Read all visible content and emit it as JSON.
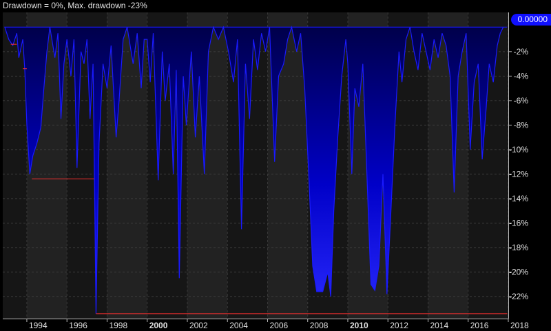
{
  "chart_data": {
    "type": "area",
    "title": "Drawdown = 0%, Max. drawdown -23%",
    "ylim": [
      -23.8,
      1.2
    ],
    "y_ticks": [
      {
        "value": -2,
        "label": "-2%"
      },
      {
        "value": -4,
        "label": "-4%"
      },
      {
        "value": -6,
        "label": "-6%"
      },
      {
        "value": -8,
        "label": "-8%"
      },
      {
        "value": -10,
        "label": "-10%"
      },
      {
        "value": -12,
        "label": "-12%"
      },
      {
        "value": -14,
        "label": "-14%"
      },
      {
        "value": -16,
        "label": "-16%"
      },
      {
        "value": -18,
        "label": "-18%"
      },
      {
        "value": -20,
        "label": "-20%"
      },
      {
        "value": -22,
        "label": "-22%"
      }
    ],
    "x_ticks": [
      {
        "year": 1994,
        "label": "1994",
        "bold": false
      },
      {
        "year": 1996,
        "label": "1996",
        "bold": false
      },
      {
        "year": 1998,
        "label": "1998",
        "bold": false
      },
      {
        "year": 2000,
        "label": "2000",
        "bold": true
      },
      {
        "year": 2002,
        "label": "2002",
        "bold": false
      },
      {
        "year": 2004,
        "label": "2004",
        "bold": false
      },
      {
        "year": 2006,
        "label": "2006",
        "bold": false
      },
      {
        "year": 2008,
        "label": "2008",
        "bold": false
      },
      {
        "year": 2010,
        "label": "2010",
        "bold": true
      },
      {
        "year": 2012,
        "label": "2012",
        "bold": false
      },
      {
        "year": 2014,
        "label": "2014",
        "bold": false
      },
      {
        "year": 2016,
        "label": "2016",
        "bold": false
      },
      {
        "year": 2018,
        "label": "2018",
        "bold": false
      }
    ],
    "last_value_label": "0.00000",
    "series": [
      {
        "type": "area",
        "color": "#1a1aff",
        "points": [
          [
            1992.9,
            0
          ],
          [
            1993.1,
            -1.0
          ],
          [
            1993.3,
            -1.5
          ],
          [
            1993.5,
            -0.5
          ],
          [
            1993.6,
            -2.5
          ],
          [
            1993.8,
            -1.0
          ],
          [
            1993.9,
            -3.5
          ],
          [
            1994.0,
            -8
          ],
          [
            1994.15,
            -12.0
          ],
          [
            1994.3,
            -10.5
          ],
          [
            1994.5,
            -9.5
          ],
          [
            1994.7,
            -8.2
          ],
          [
            1994.85,
            -5
          ],
          [
            1995.0,
            -2
          ],
          [
            1995.15,
            0
          ],
          [
            1995.4,
            -2.5
          ],
          [
            1995.55,
            -0.5
          ],
          [
            1995.7,
            -7.5
          ],
          [
            1995.85,
            -3
          ],
          [
            1996.0,
            -1
          ],
          [
            1996.2,
            -4
          ],
          [
            1996.35,
            -1
          ],
          [
            1996.5,
            -11.5
          ],
          [
            1996.7,
            -2
          ],
          [
            1996.85,
            -3
          ],
          [
            1997.0,
            -1
          ],
          [
            1997.15,
            -7.5
          ],
          [
            1997.3,
            -3
          ],
          [
            1997.45,
            -23.4
          ],
          [
            1997.6,
            -9.5
          ],
          [
            1997.8,
            -3.0
          ],
          [
            1998.0,
            -5.0
          ],
          [
            1998.2,
            -1.5
          ],
          [
            1998.45,
            -9.0
          ],
          [
            1998.6,
            -6.0
          ],
          [
            1998.8,
            -1.0
          ],
          [
            1999.0,
            0
          ],
          [
            1999.3,
            -3.0
          ],
          [
            1999.5,
            -0.5
          ],
          [
            1999.7,
            -5.0
          ],
          [
            1999.85,
            -1
          ],
          [
            2000.0,
            -1
          ],
          [
            2000.15,
            -4.5
          ],
          [
            2000.3,
            -0.5
          ],
          [
            2000.55,
            -12.5
          ],
          [
            2000.75,
            -2.0
          ],
          [
            2000.9,
            -6.0
          ],
          [
            2001.1,
            -3.0
          ],
          [
            2001.3,
            -12.0
          ],
          [
            2001.45,
            -3.5
          ],
          [
            2001.6,
            -20.5
          ],
          [
            2001.8,
            -4.0
          ],
          [
            2001.95,
            -8.0
          ],
          [
            2002.2,
            -2.0
          ],
          [
            2002.4,
            -9.0
          ],
          [
            2002.6,
            -4.0
          ],
          [
            2002.85,
            -12.0
          ],
          [
            2003.05,
            -2.0
          ],
          [
            2003.3,
            0
          ],
          [
            2003.55,
            -1.0
          ],
          [
            2003.8,
            0
          ],
          [
            2004.05,
            -2.0
          ],
          [
            2004.3,
            -4.5
          ],
          [
            2004.5,
            -1.0
          ],
          [
            2004.7,
            -16.5
          ],
          [
            2004.9,
            -3.0
          ],
          [
            2005.1,
            -7.5
          ],
          [
            2005.3,
            -1.0
          ],
          [
            2005.5,
            -3.5
          ],
          [
            2005.7,
            -0.5
          ],
          [
            2005.9,
            -2.0
          ],
          [
            2006.1,
            0
          ],
          [
            2006.35,
            -11.0
          ],
          [
            2006.55,
            -4.0
          ],
          [
            2006.8,
            -3.0
          ],
          [
            2007.0,
            -1.0
          ],
          [
            2007.2,
            0
          ],
          [
            2007.45,
            -2.0
          ],
          [
            2007.65,
            -0.5
          ],
          [
            2007.85,
            -5.0
          ],
          [
            2008.05,
            -12.0
          ],
          [
            2008.25,
            -19.5
          ],
          [
            2008.45,
            -21.6
          ],
          [
            2008.75,
            -21.6
          ],
          [
            2009.0,
            -20.0
          ],
          [
            2009.15,
            -22.0
          ],
          [
            2009.3,
            -15.0
          ],
          [
            2009.5,
            -9.0
          ],
          [
            2009.7,
            -4.0
          ],
          [
            2009.9,
            -1.0
          ],
          [
            2010.0,
            -3.0
          ],
          [
            2010.2,
            -12.0
          ],
          [
            2010.35,
            -5.0
          ],
          [
            2010.55,
            -6.5
          ],
          [
            2010.75,
            -3.0
          ],
          [
            2010.95,
            -12.0
          ],
          [
            2011.15,
            -21.0
          ],
          [
            2011.35,
            -21.5
          ],
          [
            2011.55,
            -19.5
          ],
          [
            2011.75,
            -12.0
          ],
          [
            2011.95,
            -21.8
          ],
          [
            2012.15,
            -15.0
          ],
          [
            2012.35,
            -8.0
          ],
          [
            2012.55,
            -2.0
          ],
          [
            2012.7,
            -4.5
          ],
          [
            2012.9,
            -1.0
          ],
          [
            2013.1,
            0
          ],
          [
            2013.3,
            -2.0
          ],
          [
            2013.5,
            -3.5
          ],
          [
            2013.7,
            -0.5
          ],
          [
            2013.9,
            -2.0
          ],
          [
            2014.1,
            -3.5
          ],
          [
            2014.3,
            -1.0
          ],
          [
            2014.5,
            -2.5
          ],
          [
            2014.7,
            -0.5
          ],
          [
            2014.9,
            -1.5
          ],
          [
            2015.1,
            -4.0
          ],
          [
            2015.3,
            -13.5
          ],
          [
            2015.5,
            -4.0
          ],
          [
            2015.7,
            -2.0
          ],
          [
            2015.9,
            -0.5
          ],
          [
            2016.1,
            -10.0
          ],
          [
            2016.3,
            -4.5
          ],
          [
            2016.5,
            -3.0
          ],
          [
            2016.7,
            -10.8
          ],
          [
            2016.9,
            -6.5
          ],
          [
            2017.05,
            -3.0
          ],
          [
            2017.25,
            -4.5
          ],
          [
            2017.45,
            -1.5
          ],
          [
            2017.6,
            -0.5
          ],
          [
            2017.75,
            0
          ],
          [
            2017.95,
            0
          ]
        ]
      }
    ],
    "max_drawdown_steps": {
      "color": "#ff3030",
      "segments": [
        {
          "x0": 1993.2,
          "x1": 1993.5,
          "y": -1.4
        },
        {
          "x0": 1993.8,
          "x1": 1994.0,
          "y": -3.4
        },
        {
          "x0": 1994.25,
          "x1": 1997.35,
          "y": -12.4
        },
        {
          "x0": 1997.45,
          "x1": 2017.95,
          "y": -23.4
        }
      ]
    },
    "grid": true
  }
}
